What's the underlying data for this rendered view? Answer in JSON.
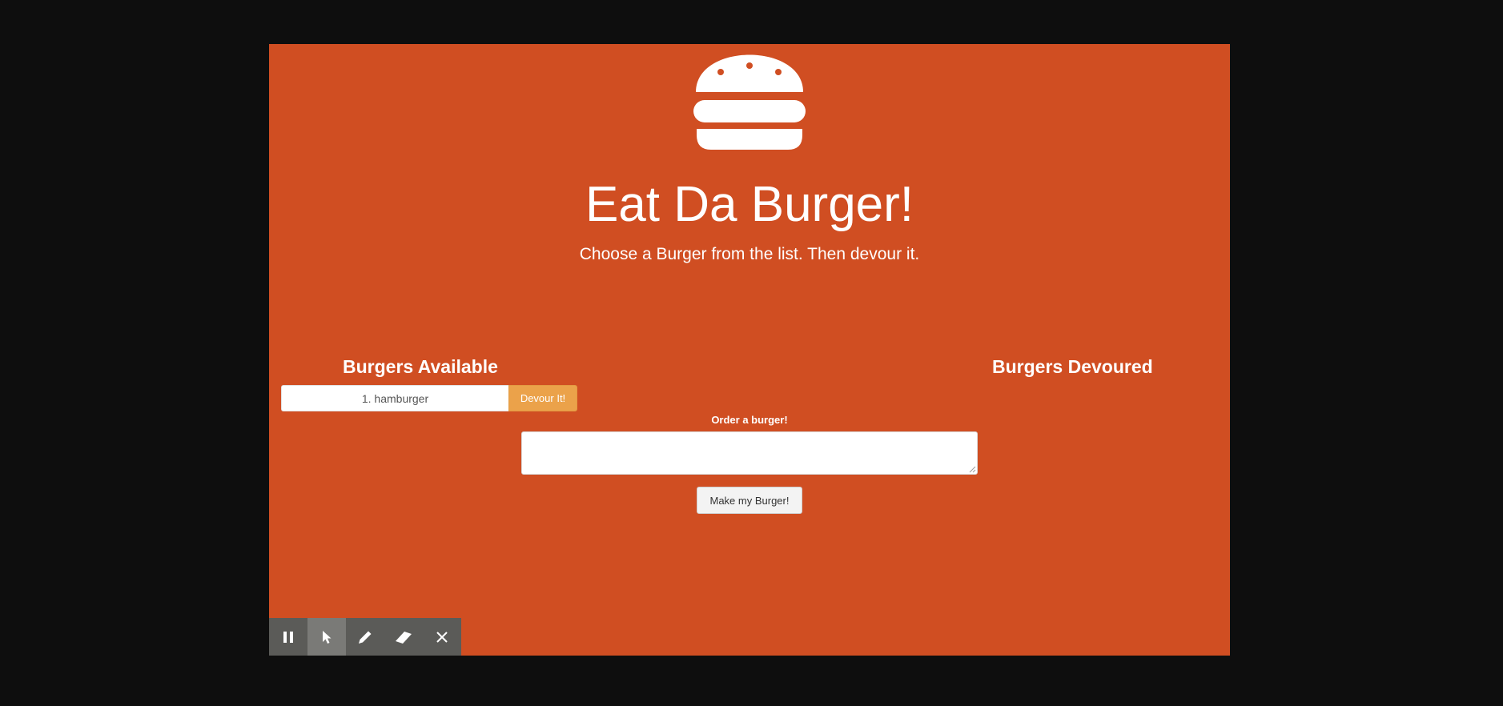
{
  "app": {
    "title": "Eat Da Burger!",
    "subtitle": "Choose a Burger from the list. Then devour it.",
    "logo_icon": "hamburger-icon"
  },
  "columns": {
    "available_heading": "Burgers Available",
    "devoured_heading": "Burgers Devoured"
  },
  "burgers_available": [
    {
      "label": "1. hamburger",
      "action_label": "Devour It!"
    }
  ],
  "burgers_devoured": [],
  "order_form": {
    "label": "Order a burger!",
    "value": "",
    "placeholder": "",
    "submit_label": "Make my Burger!"
  },
  "toolbar": {
    "items": [
      {
        "icon": "pause-icon",
        "active": false
      },
      {
        "icon": "cursor-icon",
        "active": true
      },
      {
        "icon": "pencil-icon",
        "active": false
      },
      {
        "icon": "eraser-icon",
        "active": false
      },
      {
        "icon": "close-icon",
        "active": false
      }
    ]
  },
  "colors": {
    "background": "#d04e22",
    "devour_button": "#eba24a",
    "frame": "#0e0e0e",
    "toolbar": "#5b5b58"
  }
}
